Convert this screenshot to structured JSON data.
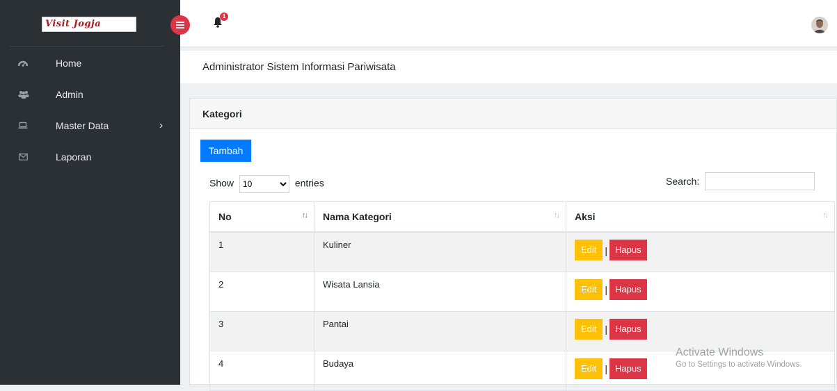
{
  "brand": {
    "logo_text": "Visit Jogja"
  },
  "sidebar": {
    "items": [
      {
        "label": "Home",
        "icon": "dashboard-icon"
      },
      {
        "label": "Admin",
        "icon": "users-icon"
      },
      {
        "label": "Master Data",
        "icon": "laptop-icon",
        "chevron": "›"
      },
      {
        "label": "Laporan",
        "icon": "envelope-icon"
      }
    ]
  },
  "topbar": {
    "notification_count": "1"
  },
  "page": {
    "title": "Administrator Sistem Informasi Pariwisata"
  },
  "card": {
    "title": "Kategori",
    "add_button": "Tambah"
  },
  "datatable": {
    "show_label": "Show",
    "entries_label": "entries",
    "length_value": "10",
    "length_options": [
      "10"
    ],
    "search_label": "Search:",
    "columns": [
      "No",
      "Nama Kategori",
      "Aksi"
    ],
    "rows": [
      {
        "no": "1",
        "nama": "Kuliner",
        "edit": "Edit",
        "hapus": "Hapus"
      },
      {
        "no": "2",
        "nama": "Wisata Lansia",
        "edit": "Edit",
        "hapus": "Hapus"
      },
      {
        "no": "3",
        "nama": "Pantai",
        "edit": "Edit",
        "hapus": "Hapus"
      },
      {
        "no": "4",
        "nama": "Budaya",
        "edit": "Edit",
        "hapus": "Hapus"
      }
    ],
    "separator": "|"
  },
  "watermark": {
    "title": "Activate Windows",
    "subtitle": "Go to Settings to activate Windows."
  },
  "colors": {
    "sidebar": "#2b3035",
    "primary": "#007bff",
    "warning": "#ffc107",
    "danger": "#dc3545"
  }
}
